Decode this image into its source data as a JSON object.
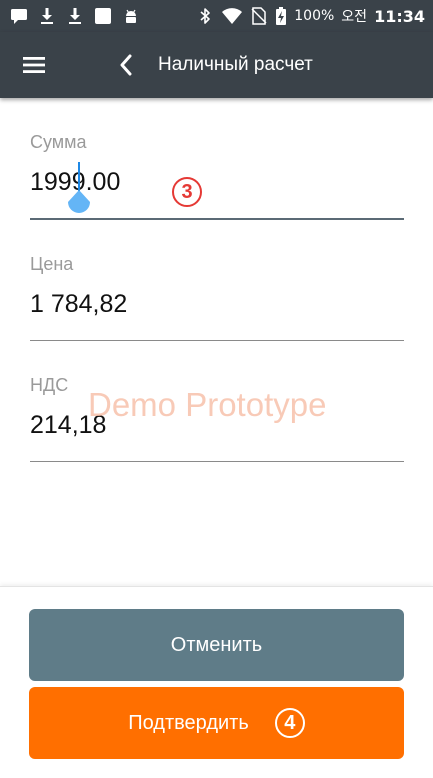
{
  "status_bar": {
    "battery_percent": "100%",
    "period": "오전",
    "time": "11:34",
    "left_icons": [
      "message-icon",
      "download-icon",
      "download-icon",
      "blank-square-icon",
      "android-icon"
    ],
    "right_icons": [
      "bluetooth-icon",
      "wifi-icon",
      "no-sim-icon",
      "battery-charging-icon"
    ]
  },
  "app_bar": {
    "title": "Наличный расчет",
    "menu_icon": "hamburger-menu-icon",
    "back_icon": "chevron-left-icon"
  },
  "fields": {
    "sum": {
      "label": "Сумма",
      "value": "1999.00"
    },
    "price": {
      "label": "Цена",
      "value": "1 784,82"
    },
    "vat": {
      "label": "НДС",
      "value": "214,18"
    }
  },
  "annotations": {
    "step3": "3",
    "step4": "4"
  },
  "watermark": "Demo Prototype",
  "buttons": {
    "cancel": "Отменить",
    "confirm": "Подтвердить"
  },
  "colors": {
    "bar_bg": "#3a4249",
    "cancel_bg": "#5f7c88",
    "confirm_bg": "#ff6f00",
    "cursor": "#1e88e5",
    "annotation": "#e53935"
  }
}
